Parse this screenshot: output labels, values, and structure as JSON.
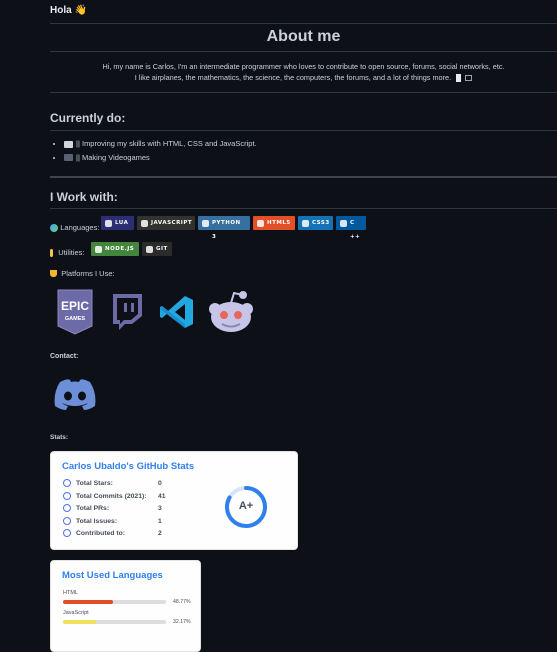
{
  "greeting": "Hola 👋",
  "about": {
    "title": "About me",
    "line1": "Hi, my name is Carlos, I'm an intermediate programmer who loves to contribute to open source, forums, social networks, etc.",
    "line2": "I like airplanes, the mathematics, the science, the computers, the forums, and a lot of things more."
  },
  "currently": {
    "title": "Currently do:",
    "items": [
      "|| Improving my skills with HTML, CSS and JavaScript.",
      "|| Making Videogames"
    ]
  },
  "work": {
    "title": "I Work with:",
    "languages_label": "Languages:",
    "languages": [
      {
        "label": "lua",
        "color": "#2c2d72"
      },
      {
        "label": "javascript",
        "color": "#323330"
      },
      {
        "label": "python 3",
        "color": "#3670a0"
      },
      {
        "label": "html5",
        "color": "#e34f26"
      },
      {
        "label": "css3",
        "color": "#1572b6"
      },
      {
        "label": "c ++",
        "color": "#00599c"
      }
    ],
    "utilities_label": "Utilities:",
    "utilities": [
      {
        "label": "node.js",
        "color": "#43853d"
      },
      {
        "label": "git",
        "color": "#2b2b2b"
      }
    ],
    "platforms_label": "Platforms I Use:",
    "platforms": [
      "epic-games-logo",
      "twitch-logo",
      "visual-studio-code-logo",
      "reddit-logo"
    ]
  },
  "contact": {
    "label": "Contact:",
    "icon": "discord-logo"
  },
  "stats": {
    "label": "Stats:",
    "card_title": "Carlos Ubaldo's GitHub Stats",
    "rows": [
      {
        "label": "Total Stars:",
        "value": "0"
      },
      {
        "label": "Total Commits (2021):",
        "value": "41"
      },
      {
        "label": "Total PRs:",
        "value": "3"
      },
      {
        "label": "Total Issues:",
        "value": "1"
      },
      {
        "label": "Contributed to:",
        "value": "2"
      }
    ],
    "grade": "A+",
    "accent": "#2f80ed"
  },
  "languages_card": {
    "title": "Most Used Languages",
    "langs": [
      {
        "name": "HTML",
        "pct": "48.77%",
        "fraction": 0.4877,
        "color": "#e34c26"
      },
      {
        "name": "JavaScript",
        "pct": "32.17%",
        "fraction": 0.3217,
        "color": "#f1e05a"
      }
    ]
  }
}
